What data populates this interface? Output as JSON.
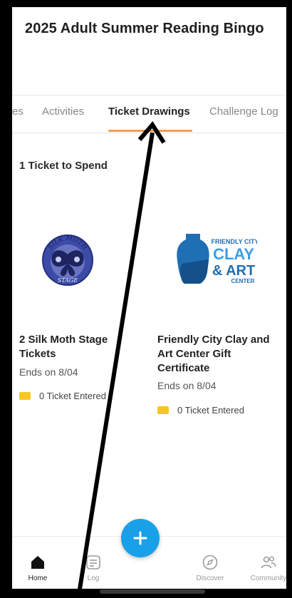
{
  "header": {
    "title": "2025 Adult Summer Reading Bingo"
  },
  "tabs": [
    {
      "label": "es"
    },
    {
      "label": "Activities"
    },
    {
      "label": "Ticket Drawings",
      "active": true
    },
    {
      "label": "Challenge Log"
    }
  ],
  "tickets": {
    "to_spend": "1 Ticket to Spend"
  },
  "cards": [
    {
      "title": "2 Silk Moth Stage Tickets",
      "ends": "Ends on 8/04",
      "entered": "0 Ticket Entered",
      "logo": {
        "arc_text": "SILK MOTH",
        "bottom_text": "STAGE",
        "icon": "moth-logo-icon"
      }
    },
    {
      "title": "Friendly City Clay and Art Center Gift Certificate",
      "ends": "Ends on 8/04",
      "entered": "0 Ticket Entered",
      "logo": {
        "line1": "FRIENDLY CITY",
        "line2": "CLAY",
        "line3": "& ART",
        "line4": "CENTER",
        "icon": "vase-logo-icon"
      }
    }
  ],
  "bottom_nav": [
    {
      "label": "Home",
      "icon": "home-icon",
      "active": true
    },
    {
      "label": "Log",
      "icon": "log-icon"
    },
    {
      "label": "Discover",
      "icon": "compass-icon"
    },
    {
      "label": "Community",
      "icon": "community-icon"
    }
  ],
  "fab": {
    "icon": "plus-icon"
  },
  "colors": {
    "accent": "#f2a04c",
    "fab": "#1aa0e8",
    "ticket": "#f7c623",
    "clay_blue": "#1f6fb5",
    "moth_blue": "#2b3a8f"
  }
}
